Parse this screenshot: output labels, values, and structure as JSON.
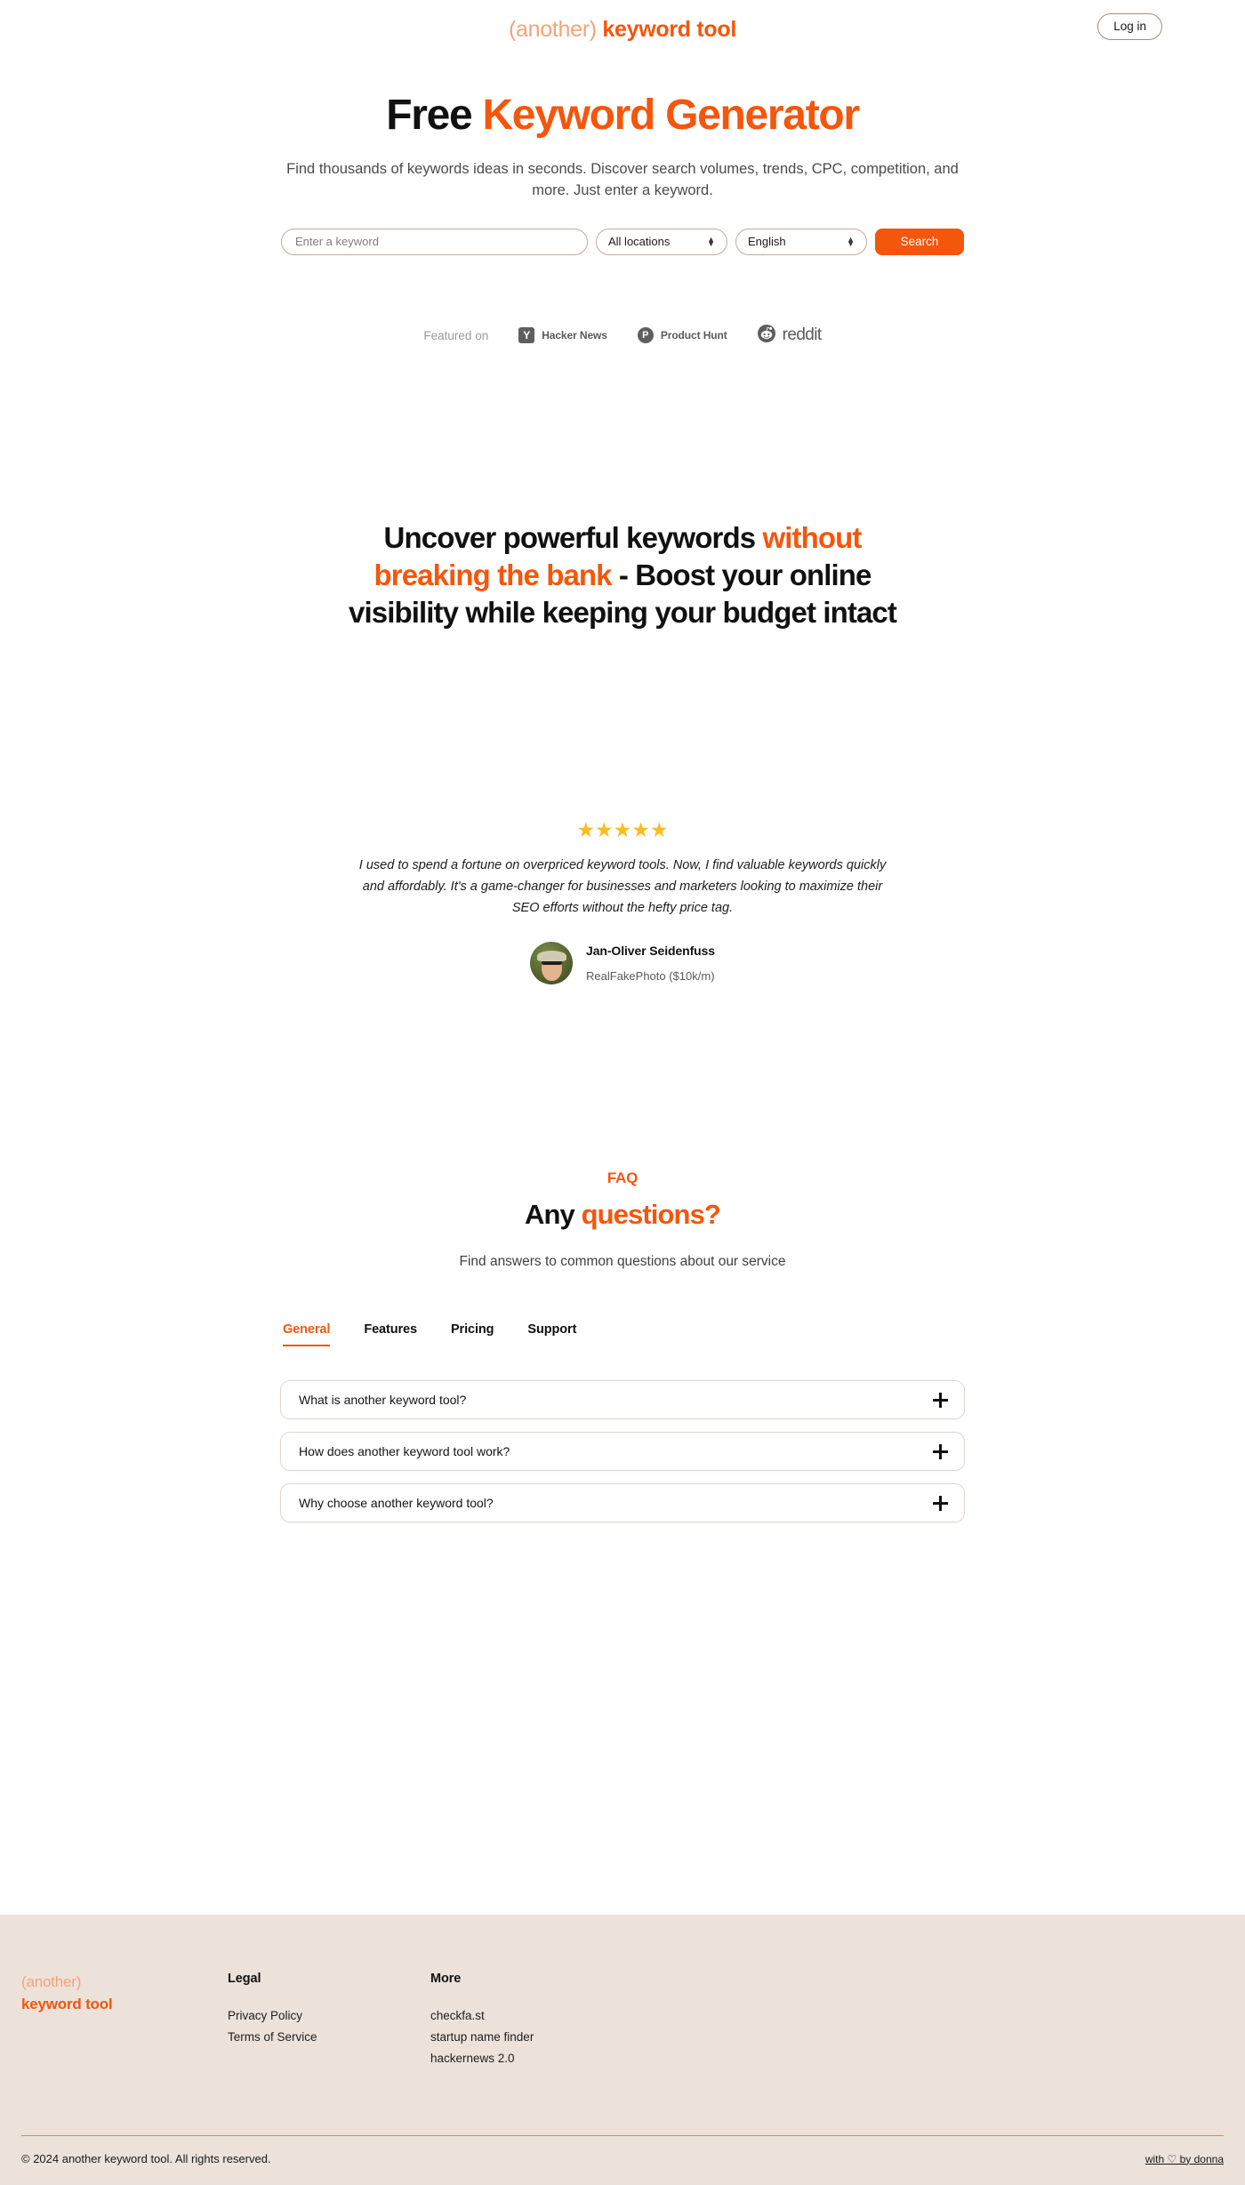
{
  "header": {
    "brand_prefix": "(another)",
    "brand_main": "keyword tool",
    "login_label": "Log in"
  },
  "hero": {
    "title_plain": "Free ",
    "title_accent": "Keyword Generator",
    "subtitle": "Find thousands of keywords ideas in seconds. Discover search volumes, trends, CPC, competition, and more. Just enter a keyword.",
    "search": {
      "keyword_placeholder": "Enter a keyword",
      "keyword_value": "",
      "location_selected": "All locations",
      "language_selected": "English",
      "search_label": "Search"
    }
  },
  "featured": {
    "label": "Featured on",
    "items": [
      {
        "name": "Hacker News",
        "icon": "hacker-news-icon",
        "glyph": "Y"
      },
      {
        "name": "Product Hunt",
        "icon": "product-hunt-icon",
        "glyph": "P"
      },
      {
        "name": "reddit",
        "icon": "reddit-icon",
        "glyph": ""
      }
    ]
  },
  "statement": {
    "part1": "Uncover powerful keywords ",
    "accent1": "without breaking the bank",
    "part2": " - Boost your online visibility while keeping your budget intact"
  },
  "testimonial": {
    "stars": "★★★★★",
    "star_count": 5,
    "quote": "I used to spend a fortune on overpriced keyword tools. Now, I find valuable keywords quickly and affordably. It's a game-changer for businesses and marketers looking to maximize their SEO efforts without the hefty price tag.",
    "author_name": "Jan-Oliver Seidenfuss",
    "author_meta": "RealFakePhoto ($10k/m)"
  },
  "faq": {
    "kicker": "FAQ",
    "title_plain": "Any ",
    "title_accent": "questions?",
    "subtitle": "Find answers to common questions about our service",
    "tabs": [
      {
        "label": "General",
        "active": true
      },
      {
        "label": "Features",
        "active": false
      },
      {
        "label": "Pricing",
        "active": false
      },
      {
        "label": "Support",
        "active": false
      }
    ],
    "items": [
      {
        "question": "What is another keyword tool?",
        "expanded": false
      },
      {
        "question": "How does another keyword tool work?",
        "expanded": false
      },
      {
        "question": "Why choose another keyword tool?",
        "expanded": false
      }
    ]
  },
  "footer": {
    "brand_prefix": "(another)",
    "brand_main": "keyword tool",
    "columns": [
      {
        "title": "Legal",
        "links": [
          "Privacy Policy",
          "Terms of Service"
        ]
      },
      {
        "title": "More",
        "links": [
          "checkfa.st",
          "startup name finder",
          "hackernews 2.0"
        ]
      }
    ],
    "copyright": "© 2024 another keyword tool. All rights reserved.",
    "credit": "with ♡ by donna"
  },
  "colors": {
    "accent_orange": "#f4560c",
    "accent_light_orange": "#f7a278",
    "star_yellow": "#fbbc1e",
    "footer_bg": "#ece2da",
    "border_tan": "#c4ab9b"
  }
}
